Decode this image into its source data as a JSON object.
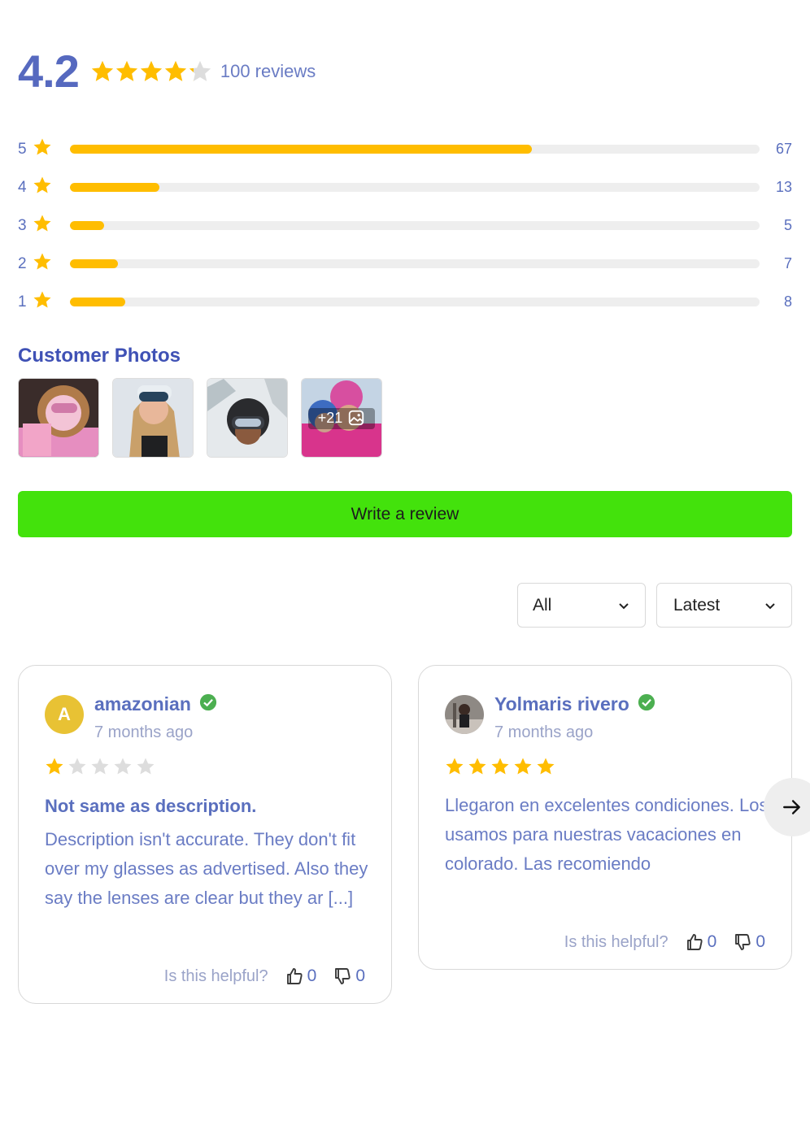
{
  "summary": {
    "average": "4.2",
    "average_value": 4.2,
    "reviews_label": "100 reviews"
  },
  "colors": {
    "star": "#ffbd00",
    "star_empty": "#dddddd",
    "button": "#43e20c",
    "accent": "#5a6fbe",
    "verified": "#4caf50"
  },
  "distribution": [
    {
      "stars": "5",
      "count": "67",
      "fraction": 0.67
    },
    {
      "stars": "4",
      "count": "13",
      "fraction": 0.13
    },
    {
      "stars": "3",
      "count": "5",
      "fraction": 0.05
    },
    {
      "stars": "2",
      "count": "7",
      "fraction": 0.07
    },
    {
      "stars": "1",
      "count": "8",
      "fraction": 0.08
    }
  ],
  "photos": {
    "title": "Customer Photos",
    "more_label": "+21",
    "more_icon": "image-icon"
  },
  "write_review": {
    "label": "Write a review"
  },
  "filters": {
    "rating": "All",
    "sort": "Latest"
  },
  "reviews": [
    {
      "author": "amazonian",
      "avatar_letter": "A",
      "time": "7 months ago",
      "rating": 1,
      "title": "Not same as description.",
      "body": "Description isn't accurate. They don't fit over my glasses as advertised. Also they say the lenses are clear but they ar [...]",
      "helpful_label": "Is this helpful?",
      "up": "0",
      "down": "0"
    },
    {
      "author": "Yolmaris rivero",
      "time": "7 months ago",
      "rating": 5,
      "title": "",
      "body": "Llegaron en excelentes condiciones. Los usamos para nuestras vacaciones en colorado. Las recomiendo",
      "helpful_label": "Is this helpful?",
      "up": "0",
      "down": "0"
    }
  ],
  "icons": {
    "next": "arrow-right-icon",
    "chevron": "chevron-down-icon",
    "verified": "check-circle-icon",
    "like": "thumbs-up-icon",
    "dislike": "thumbs-down-icon"
  }
}
